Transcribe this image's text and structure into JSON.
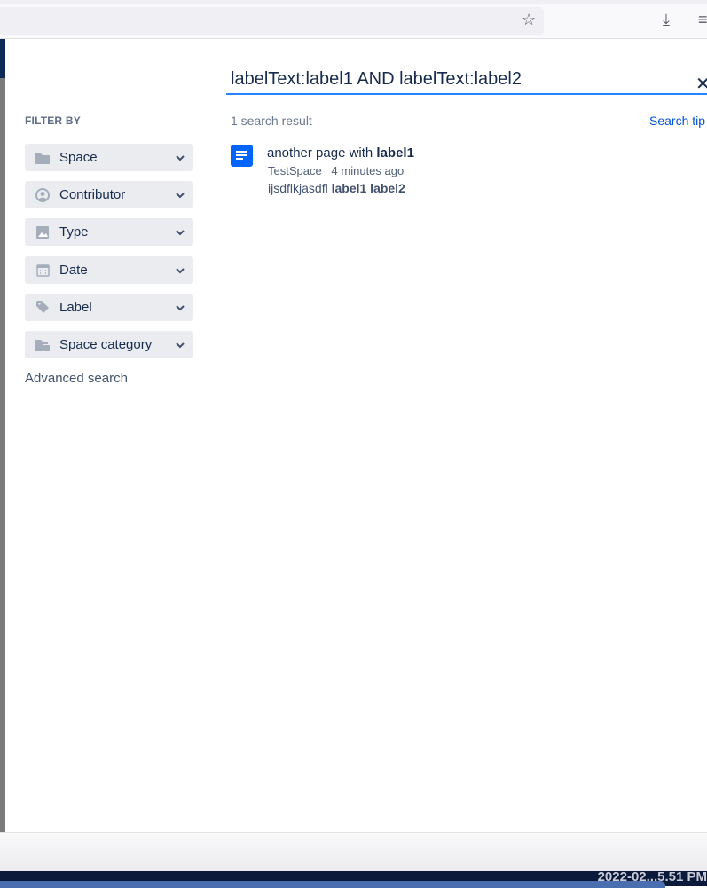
{
  "browser": {
    "icons": [
      "star-icon",
      "download-icon",
      "menu-icon"
    ]
  },
  "search": {
    "query": "labelText:label1 AND labelText:label2",
    "close_label": "✕"
  },
  "filters": {
    "heading": "FILTER BY",
    "items": [
      {
        "label": "Space",
        "icon": "folder-icon"
      },
      {
        "label": "Contributor",
        "icon": "person-icon"
      },
      {
        "label": "Type",
        "icon": "image-icon"
      },
      {
        "label": "Date",
        "icon": "calendar-icon"
      },
      {
        "label": "Label",
        "icon": "tag-icon"
      },
      {
        "label": "Space category",
        "icon": "folder-category-icon"
      }
    ],
    "advanced": "Advanced search"
  },
  "results": {
    "count": "1 search result",
    "tips": "Search tip",
    "items": [
      {
        "title_prefix": "another page with ",
        "title_bold": "label1",
        "space": "TestSpace",
        "time": "4 minutes ago",
        "excerpt_prefix": "ijsdflkjasdfl ",
        "excerpt_bold": "label1 label2"
      }
    ]
  },
  "taskbar": {
    "clock": "2022-02...5.51 PM"
  },
  "colors": {
    "accent": "#2684ff",
    "link": "#0052cc",
    "page_icon": "#0065ff",
    "filter_bg": "#ebecf0"
  }
}
